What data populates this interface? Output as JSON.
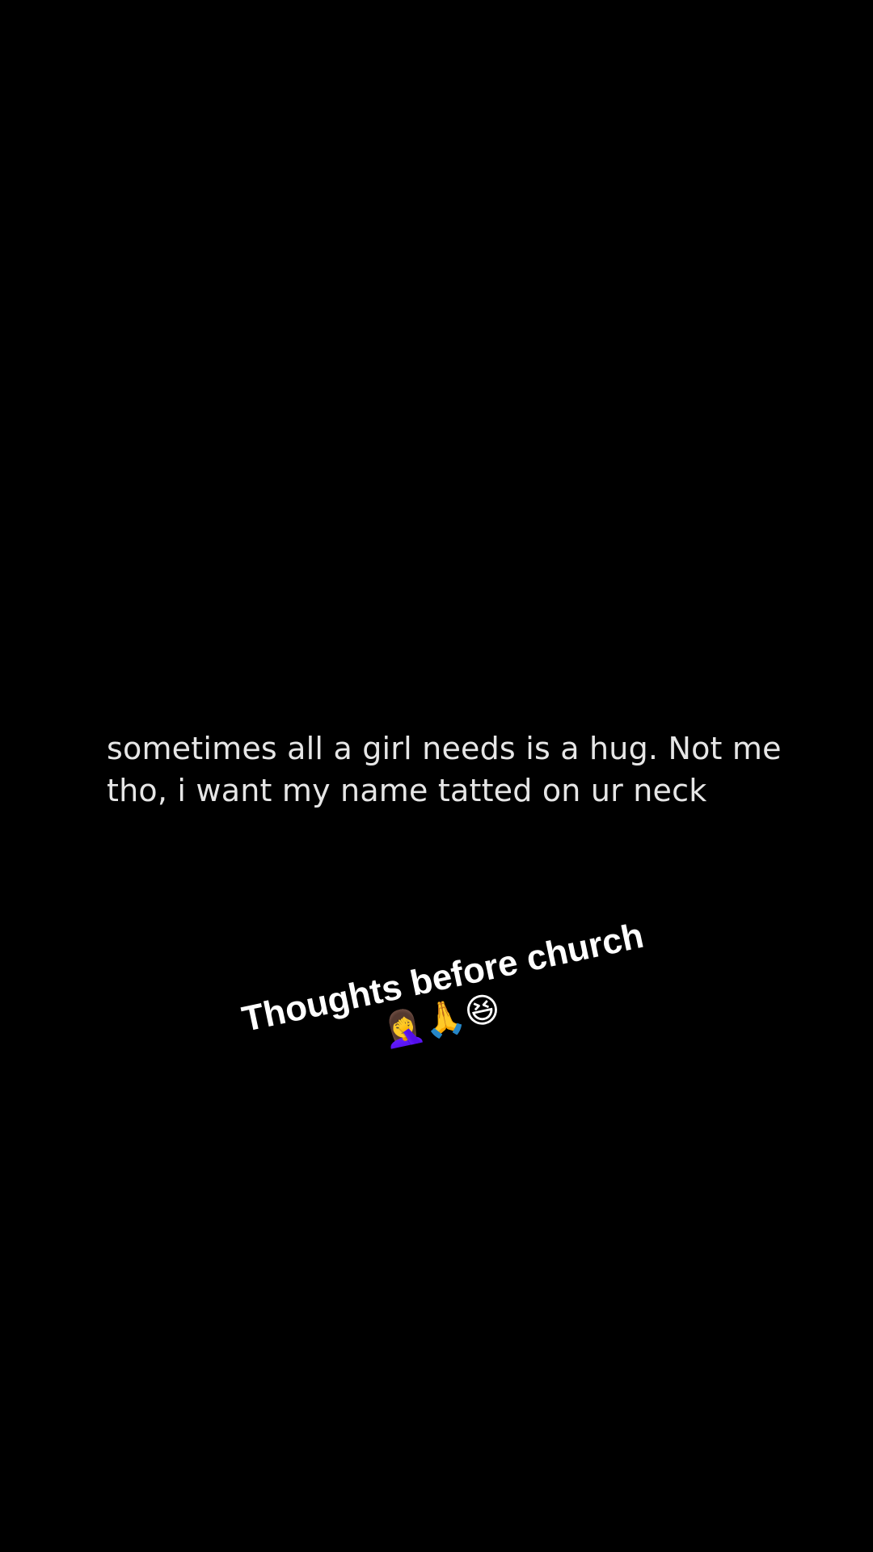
{
  "quote": {
    "line1": "sometimes all a girl needs is a hug. Not me",
    "line2": "tho, i want my name tatted on ur neck"
  },
  "caption": {
    "text": "Thoughts before church",
    "emojis": "🤦‍♀️🙏😆"
  },
  "colors": {
    "background": "#000000",
    "quote_text": "#e6e6e6",
    "caption_text": "#ffffff"
  }
}
